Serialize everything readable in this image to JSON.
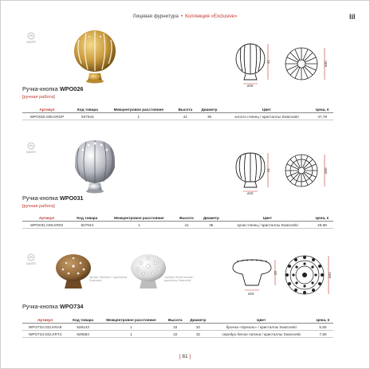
{
  "header": {
    "section": "Лицевая фурнитура",
    "separator": "•",
    "collection": "Коллекция «Exclusive»",
    "corner_mark": "lil"
  },
  "brand": {
    "logo_text": "GIUSTI"
  },
  "columns": [
    "Артикул",
    "Код товара",
    "Межцентровое расстояние",
    "Высота",
    "Диаметр",
    "Цвет",
    "Цена, €"
  ],
  "products": [
    {
      "title_prefix": "Ручка-кнопка",
      "model": "WPO026",
      "note": "[ручная работа]",
      "drawing": {
        "height_dim": "41",
        "diameter_dim": "ø35",
        "base_dim": "ø16"
      },
      "rows": [
        {
          "article": "WPO026.035.KRGP",
          "code": "927944",
          "center": "1",
          "height": "41",
          "diameter": "35",
          "color": "золото глянец / кристаллы Swarovski",
          "price": "47,78"
        }
      ]
    },
    {
      "title_prefix": "Ручка-кнопка",
      "model": "WPO031",
      "note": "[ручная работа]",
      "drawing": {
        "height_dim": "41",
        "diameter_dim": "ø35",
        "base_dim": "ø16"
      },
      "rows": [
        {
          "article": "WPO031.035.KR02",
          "code": "927943",
          "center": "1",
          "height": "41",
          "diameter": "35",
          "color": "хром глянец / кристаллы Swarovski",
          "price": "49,98"
        }
      ]
    },
    {
      "title_prefix": "Ручка-кнопка",
      "model": "WPO734",
      "note": "",
      "drawing": {
        "height_dim": "22",
        "diameter_dim": "ø32",
        "base_dim": "ø16"
      },
      "photo_labels": [
        "бронза «Ореаль» / кристаллы Swarovski",
        "серебро белое патина / кристаллы Swarovski"
      ],
      "rows": [
        {
          "article": "WPO734.032.KRA8",
          "code": "928143",
          "center": "1",
          "height": "22",
          "diameter": "32",
          "color": "бронза «Ореаль» / кристаллы Swarovski",
          "price": "5,50"
        },
        {
          "article": "WPO734.032.KRT4",
          "code": "928583",
          "center": "1",
          "height": "22",
          "diameter": "32",
          "color": "серебро белое патина / кристаллы Swarovski",
          "price": "7,50"
        }
      ]
    }
  ],
  "page": {
    "number": "81"
  },
  "colors": {
    "accent": "#c0352b",
    "gold": "#c99a3e",
    "chrome": "#b9bcc4",
    "bronze": "#8b6235",
    "silver": "#d9d9d9"
  }
}
